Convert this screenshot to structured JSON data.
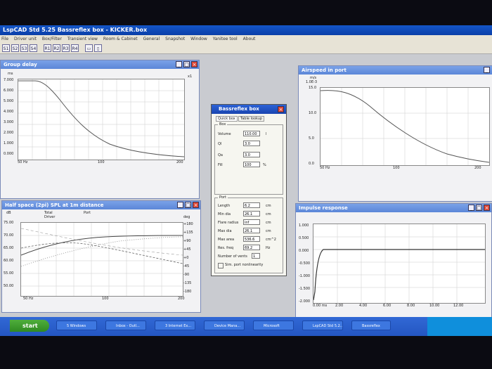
{
  "app": {
    "title": "LspCAD Std 5.25 Bassreflex box - KICKER.box"
  },
  "menu": [
    "File",
    "Driver unit",
    "Box/Filter",
    "Transient view",
    "Room & Cabinet",
    "General",
    "Snapshot",
    "Window",
    "Yanitee tool",
    "About"
  ],
  "toolbar": [
    "S1",
    "S2",
    "S3",
    "S4",
    "R1",
    "R2",
    "R3",
    "R4"
  ],
  "windows": {
    "group_delay": {
      "title": "Group delay",
      "ylabel": "ms",
      "multiplier": "x1",
      "yticks": [
        "7.000",
        "6.000",
        "5.000",
        "4.000",
        "3.000",
        "2.000",
        "1.000",
        "0.000"
      ],
      "xticks": [
        "50 Hz",
        "100",
        "200"
      ]
    },
    "airspeed": {
      "title": "Airspeed in port",
      "ylabel": "m/s",
      "multiplier": "1.0E-3",
      "yticks": [
        "15.0",
        "10.0",
        "5.0",
        "0.0"
      ],
      "xticks": [
        "50 Hz",
        "100",
        "200"
      ]
    },
    "halfspace": {
      "title": "Half space (2pi) SPL at 1m distance",
      "ylabel_left": "dB",
      "ylabel_right": "deg",
      "legend": [
        "Total",
        "Port",
        "Driver"
      ],
      "yticks_left": [
        "75.00",
        "70.00",
        "65.00",
        "60.00",
        "55.00",
        "50.00"
      ],
      "yticks_right": [
        "+180",
        "+135",
        "+90",
        "+45",
        "+0",
        "-45",
        "-90",
        "-135",
        "-180"
      ],
      "xticks": [
        "50 Hz",
        "100",
        "200"
      ]
    },
    "impulse": {
      "title": "Impulse response",
      "yticks": [
        "1.000",
        "0.500",
        "0.000",
        "-0.500",
        "-1.000",
        "-1.500",
        "-2.000"
      ],
      "xticks": [
        "0.00 ms",
        "2.00",
        "4.00",
        "6.00",
        "8.00",
        "10.00",
        "12.00"
      ]
    }
  },
  "dialog": {
    "title": "Bassreflex box",
    "tabs": [
      "Quick box",
      "Table lookup"
    ],
    "box": {
      "label": "Box",
      "fields": [
        {
          "label": "Volume",
          "value": "110.00",
          "unit": "l"
        },
        {
          "label": "Ql",
          "value": "3.0",
          "unit": ""
        },
        {
          "label": "Qa",
          "value": "3.0",
          "unit": ""
        },
        {
          "label": "Fill",
          "value": "100",
          "unit": "%"
        }
      ]
    },
    "port": {
      "label": "Port",
      "fields": [
        {
          "label": "Length",
          "value": "6.2",
          "unit": "cm"
        },
        {
          "label": "Min dia",
          "value": "26.1",
          "unit": "cm"
        },
        {
          "label": "Flare radius",
          "value": "inf",
          "unit": "cm"
        },
        {
          "label": "Max dia",
          "value": "26.1",
          "unit": "cm"
        },
        {
          "label": "Max area",
          "value": "536.6",
          "unit": "cm^2"
        },
        {
          "label": "Res. freq",
          "value": "69.2",
          "unit": "Hz"
        },
        {
          "label": "Number of vents",
          "value": "1",
          "unit": ""
        }
      ],
      "checkbox": "Sim. port nonlinearity"
    }
  },
  "taskbar": {
    "start": "start",
    "tasks": [
      "5 Windows",
      "Inbox - Outl...",
      "3 Internet Ex...",
      "Device Mana...",
      "Microsoft",
      "LspCAD",
      "LspCAD Std 5.2...",
      "Bassreflex"
    ]
  }
}
